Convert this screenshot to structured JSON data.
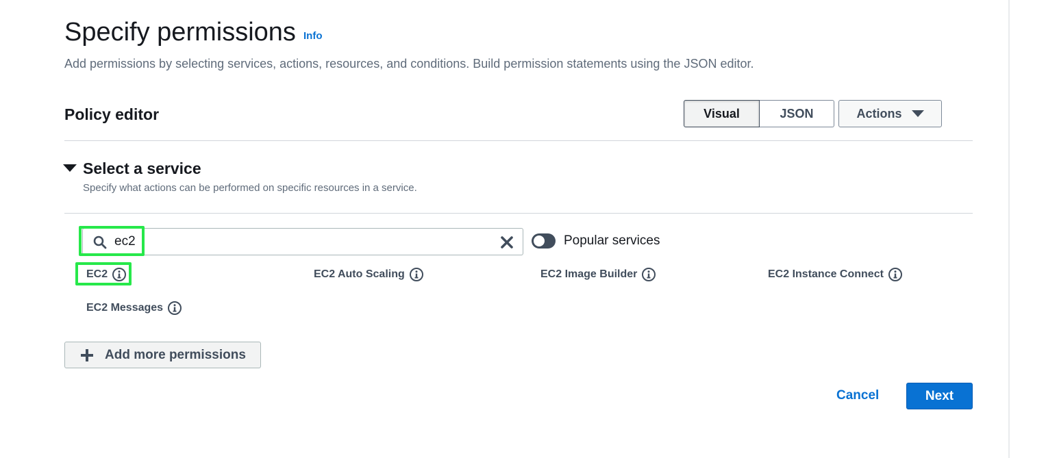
{
  "header": {
    "title": "Specify permissions",
    "info_link": "Info",
    "description": "Add permissions by selecting services, actions, resources, and conditions. Build permission statements using the JSON editor."
  },
  "policy_editor": {
    "title": "Policy editor",
    "tabs": [
      {
        "label": "Visual",
        "selected": true
      },
      {
        "label": "JSON",
        "selected": false
      }
    ],
    "actions_label": "Actions"
  },
  "select_service": {
    "heading": "Select a service",
    "description": "Specify what actions can be performed on specific resources in a service.",
    "search": {
      "value": "ec2",
      "placeholder": ""
    },
    "popular_toggle": {
      "label": "Popular services",
      "on": false
    },
    "results": [
      {
        "label": "EC2",
        "icon": "info-icon"
      },
      {
        "label": "EC2 Auto Scaling",
        "icon": "info-icon"
      },
      {
        "label": "EC2 Image Builder",
        "icon": "info-icon"
      },
      {
        "label": "EC2 Instance Connect",
        "icon": "info-icon"
      },
      {
        "label": "EC2 Messages",
        "icon": "info-icon"
      }
    ]
  },
  "add_more_label": "Add more permissions",
  "footer": {
    "cancel_label": "Cancel",
    "next_label": "Next"
  },
  "colors": {
    "primary": "#0972d3",
    "highlight": "#27e84a",
    "text": "#16191f",
    "muted_text": "#5f6b7a"
  }
}
